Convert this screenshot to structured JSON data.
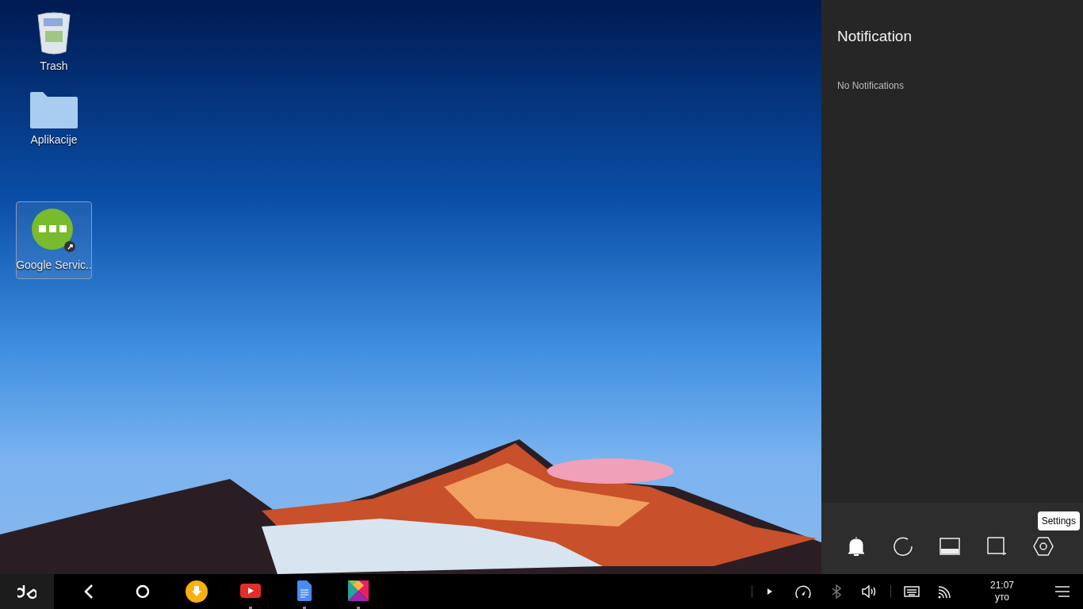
{
  "desktop": {
    "icons": [
      {
        "kind": "trash",
        "label": "Trash",
        "selected": false
      },
      {
        "kind": "folder",
        "label": "Aplikacije",
        "selected": false
      },
      {
        "kind": "app",
        "label": "Google Servic..",
        "selected": true
      }
    ]
  },
  "notification_panel": {
    "title": "Notification",
    "empty_text": "No Notifications",
    "quick_actions": [
      {
        "kind": "bell"
      },
      {
        "kind": "refresh"
      },
      {
        "kind": "screen"
      },
      {
        "kind": "crop"
      },
      {
        "kind": "settings",
        "tooltip": "Settings"
      }
    ]
  },
  "taskbar": {
    "nav": [
      {
        "kind": "back"
      },
      {
        "kind": "home"
      }
    ],
    "apps": [
      {
        "kind": "download",
        "running": false
      },
      {
        "kind": "video",
        "running": true
      },
      {
        "kind": "docs",
        "running": true
      },
      {
        "kind": "colors",
        "running": true
      }
    ],
    "tray": [
      {
        "kind": "expand",
        "disabled": false
      },
      {
        "kind": "gauge",
        "disabled": false
      },
      {
        "kind": "bluetooth",
        "disabled": true
      },
      {
        "kind": "volume",
        "disabled": false
      },
      {
        "kind": "keyboard",
        "disabled": false
      },
      {
        "kind": "signal",
        "disabled": false
      }
    ],
    "clock": {
      "time": "21:07",
      "day": "уто"
    }
  }
}
